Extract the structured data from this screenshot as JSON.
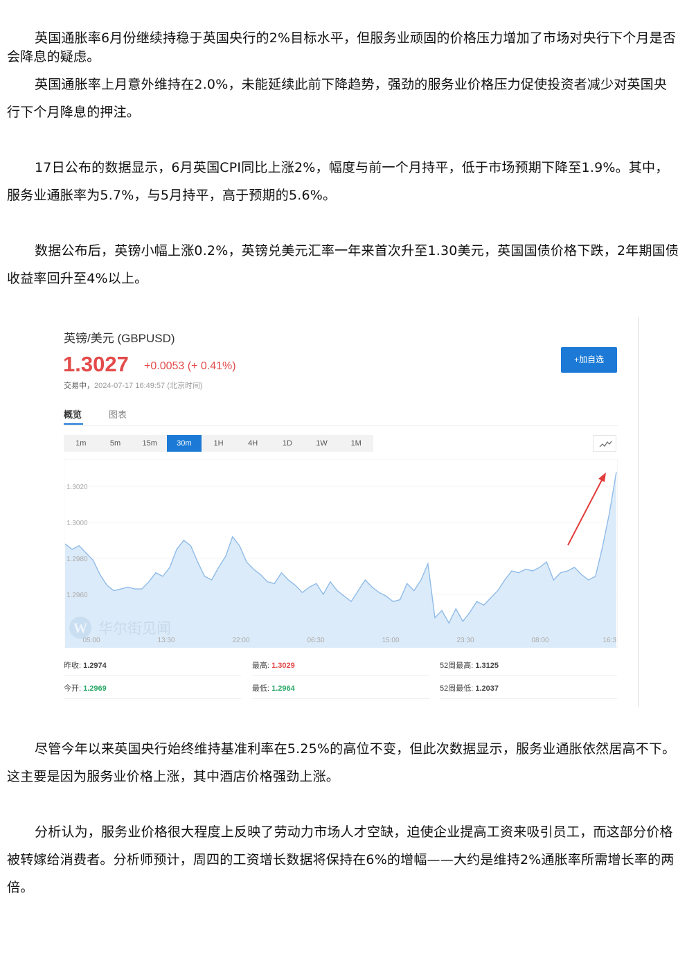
{
  "article": {
    "p1": "英国通胀率6月份继续持稳于英国央行的2%目标水平，但服务业顽固的价格压力增加了市场对央行下个月是否会降息的疑虑。",
    "p2": "英国通胀率上月意外维持在2.0%，未能延续此前下降趋势，强劲的服务业价格压力促使投资者减少对英国央行下个月降息的押注。",
    "p3": "17日公布的数据显示，6月英国CPI同比上涨2%，幅度与前一个月持平，低于市场预期下降至1.9%。其中，服务业通胀率为5.7%，与5月持平，高于预期的5.6%。",
    "p4": "数据公布后，英镑小幅上涨0.2%，英镑兑美元汇率一年来首次升至1.30美元，英国国债价格下跌，2年期国债收益率回升至4%以上。",
    "p5": "尽管今年以来英国央行始终维持基准利率在5.25%的高位不变，但此次数据显示，服务业通胀依然居高不下。这主要是因为服务业价格上涨，其中酒店价格强劲上涨。",
    "p6": "分析认为，服务业价格很大程度上反映了劳动力市场人才空缺，迫使企业提高工资来吸引员工，而这部分价格被转嫁给消费者。分析师预计，周四的工资增长数据将保持在6%的增幅——大约是维持2%通胀率所需增长率的两倍。"
  },
  "widget": {
    "title": "英镑/美元  (GBPUSD)",
    "price": "1.3027",
    "change": "+0.0053 (+ 0.41%)",
    "status_label": "交易中，",
    "timestamp": "2024-07-17 16:49:57 (北京时间)",
    "add_button": "+加自选",
    "tabs": [
      "概览",
      "图表"
    ],
    "intervals": [
      "1m",
      "5m",
      "15m",
      "30m",
      "1H",
      "4H",
      "1D",
      "1W",
      "1M"
    ],
    "active_interval": "30m",
    "watermark": "华尔街见闻",
    "accent_color": "#1c7ad6",
    "up_color": "#e34a4a",
    "down_color": "#2eaa6a",
    "stats": {
      "prev_close_label": "昨收:",
      "prev_close": "1.2974",
      "high_label": "最高:",
      "high": "1.3029",
      "high52_label": "52周最高:",
      "high52": "1.3125",
      "open_label": "今开:",
      "open": "1.2969",
      "low_label": "最低:",
      "low": "1.2964",
      "low52_label": "52周最低:",
      "low52": "1.2037"
    }
  },
  "chart_data": {
    "type": "area",
    "y_ticks": [
      "1.3020",
      "1.3000",
      "1.2980",
      "1.2960"
    ],
    "x_ticks": [
      "05:00",
      "13:30",
      "22:00",
      "06:30",
      "15:00",
      "23:30",
      "08:00",
      "16:3"
    ],
    "ylim": [
      1.2938,
      1.3035
    ],
    "values": [
      1.2988,
      1.2985,
      1.2987,
      1.2983,
      1.2979,
      1.2971,
      1.2965,
      1.2962,
      1.2963,
      1.2964,
      1.2963,
      1.2963,
      1.2967,
      1.2972,
      1.297,
      1.2975,
      1.2985,
      1.299,
      1.2987,
      1.2978,
      1.297,
      1.2968,
      1.2975,
      1.2981,
      1.2992,
      1.2987,
      1.2978,
      1.2974,
      1.2971,
      1.2967,
      1.2966,
      1.2972,
      1.2968,
      1.2965,
      1.2961,
      1.2964,
      1.2966,
      1.296,
      1.2967,
      1.2962,
      1.2959,
      1.2956,
      1.2962,
      1.2968,
      1.2964,
      1.2961,
      1.2959,
      1.2956,
      1.2957,
      1.2966,
      1.2962,
      1.2968,
      1.2977,
      1.2947,
      1.2951,
      1.2944,
      1.2952,
      1.2945,
      1.295,
      1.2956,
      1.2954,
      1.2958,
      1.2962,
      1.2968,
      1.2973,
      1.2972,
      1.2974,
      1.2973,
      1.2975,
      1.2978,
      1.2968,
      1.2972,
      1.2973,
      1.2975,
      1.2971,
      1.2968,
      1.297,
      1.2986,
      1.3005,
      1.3028
    ]
  }
}
